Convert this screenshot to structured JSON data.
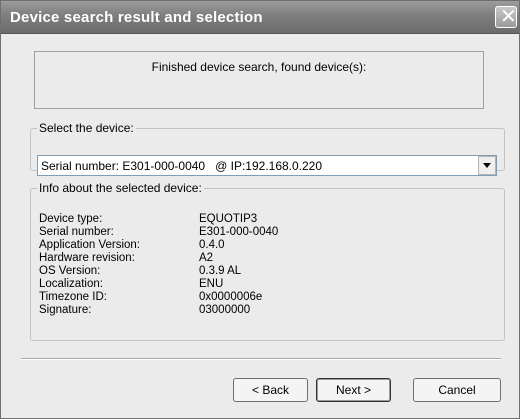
{
  "window": {
    "title": "Device search result and selection",
    "close_symbol": "✕"
  },
  "status": {
    "message": "Finished device search, found device(s):"
  },
  "select_group": {
    "legend": "Select the device:",
    "selected_value": "Serial number: E301-000-0040   @ IP:192.168.0.220"
  },
  "info_group": {
    "legend": "Info about the selected device:",
    "rows": [
      {
        "label": "Device type:",
        "value": "EQUOTIP3"
      },
      {
        "label": "Serial number:",
        "value": "E301-000-0040"
      },
      {
        "label": "Application Version:",
        "value": "0.4.0"
      },
      {
        "label": "Hardware revision:",
        "value": "A2"
      },
      {
        "label": "OS Version:",
        "value": "0.3.9 AL"
      },
      {
        "label": "Localization:",
        "value": "ENU"
      },
      {
        "label": "Timezone ID:",
        "value": "0x0000006e"
      },
      {
        "label": "Signature:",
        "value": "03000000"
      }
    ]
  },
  "buttons": {
    "back": "< Back",
    "next": "Next >",
    "cancel": "Cancel"
  },
  "icons": {
    "close": "close-icon",
    "dropdown": "chevron-down-icon"
  }
}
